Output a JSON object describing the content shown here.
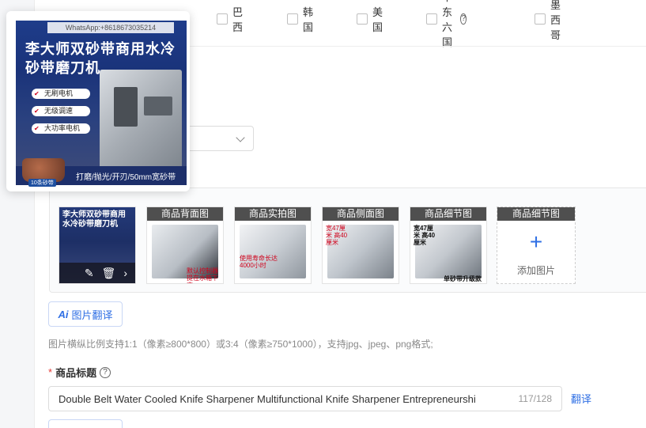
{
  "countries": [
    {
      "label": "巴西",
      "help": false
    },
    {
      "label": "韩国",
      "help": false
    },
    {
      "label": "美国",
      "help": false
    },
    {
      "label": "中东六国",
      "help": true
    },
    {
      "label": "墨西哥",
      "help": false
    }
  ],
  "popup": {
    "watermark": "WhatsApp:+8618673035214",
    "title": "李大师双砂带商用水冷砂带磨刀机",
    "features": [
      "无刷电机",
      "无级调速",
      "大功率电机"
    ],
    "bottom_strip": "打磨/抛光/开刃/50mm宽砂带",
    "badge": "10条砂带"
  },
  "gallery": {
    "main_title": "李大师双砂带商用水冷砂带磨刀机",
    "thumbs": [
      {
        "caption": "商品背面图",
        "red_text": "默认控制器 提在水箱下方"
      },
      {
        "caption": "商品实拍图",
        "red_text": "使用寿命长达4000小时"
      },
      {
        "caption": "商品侧面图",
        "red_text": "宽47厘米 高40厘米"
      },
      {
        "caption": "商品细节图",
        "red_text": "宽47厘米 高40厘米"
      }
    ],
    "thumb_badge": "单砂带升级款",
    "add_caption": "商品细节图",
    "add_label": "添加图片"
  },
  "image_translate": {
    "ai": "Ai",
    "label": "图片翻译"
  },
  "hint": "图片横纵比例支持1:1（像素≥800*800）或3:4（像素≥750*1000），支持jpg、jpeg、png格式;",
  "product_title": {
    "required_mark": "*",
    "label": "商品标题",
    "help": "?",
    "value": "Double Belt Water Cooled Knife Sharpener Multifunctional Knife Sharpener Entrepreneurshi",
    "counter": "117/128",
    "translate_link": "翻译"
  },
  "colors": {
    "accent": "#2f6fe4",
    "required": "#e53935"
  }
}
